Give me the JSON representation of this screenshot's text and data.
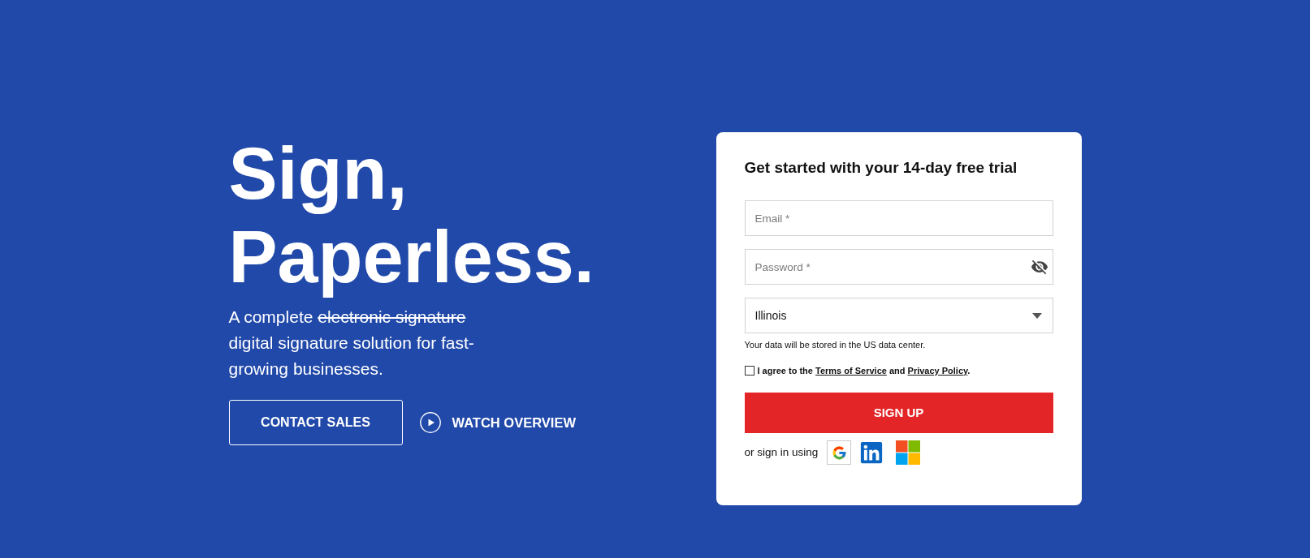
{
  "hero": {
    "title": "Sign, Paperless.",
    "subtitle": [
      {
        "text": "A complete ",
        "struck": false
      },
      {
        "text": "electronic signature",
        "struck": true
      },
      {
        "text": " digital signature solution for fast-growing businesses.",
        "struck": false
      }
    ],
    "buttons": [
      {
        "kind": "outline",
        "label": "CONTACT SALES"
      },
      {
        "kind": "play",
        "label": "WATCH OVERVIEW"
      }
    ]
  },
  "signup_card": {
    "title": "Get started with your 14-day free trial",
    "fields": [
      {
        "kind": "email",
        "placeholder": "Email *"
      },
      {
        "kind": "password",
        "placeholder": "Password *"
      },
      {
        "kind": "select",
        "value": "Illinois"
      }
    ],
    "note": "Your data will be stored in the US data center.",
    "agreement": {
      "checked": false,
      "parts": [
        {
          "text": "I agree to the ",
          "link": false
        },
        {
          "text": "Terms of Service",
          "link": true
        },
        {
          "text": " and ",
          "link": false
        },
        {
          "text": "Privacy Policy",
          "link": true
        },
        {
          "text": ".",
          "link": false
        }
      ]
    },
    "submit": "SIGN UP",
    "social_label": "or sign in using",
    "social": [
      {
        "kind": "google"
      },
      {
        "kind": "linkedin"
      },
      {
        "kind": "microsoft"
      }
    ]
  }
}
